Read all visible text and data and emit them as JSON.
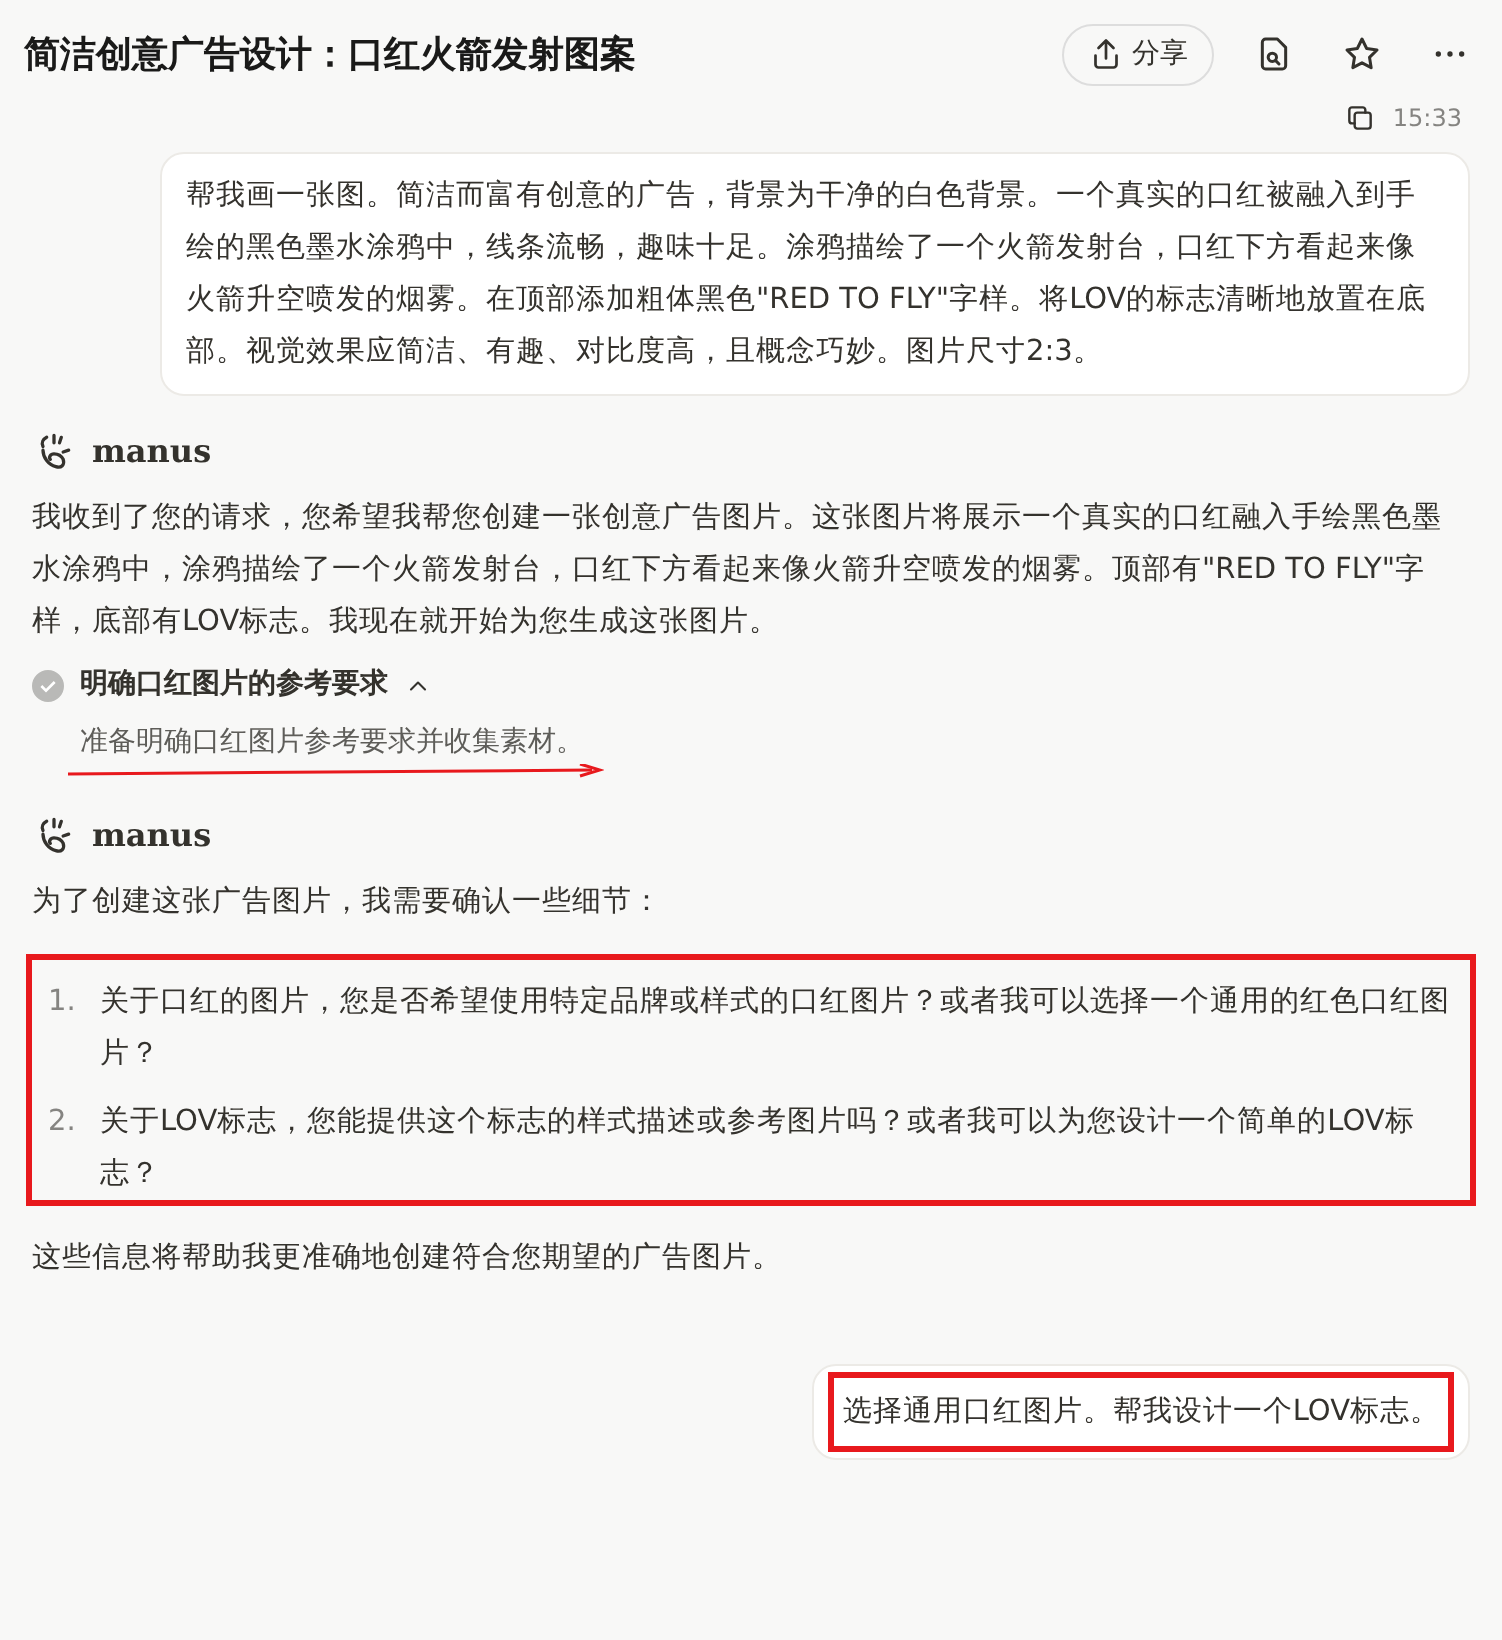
{
  "header": {
    "title": "简洁创意广告设计：口红火箭发射图案",
    "share_label": "分享"
  },
  "messages": [
    {
      "kind": "user",
      "time": "15:33",
      "text": "帮我画一张图。简洁而富有创意的广告，背景为干净的白色背景。一个真实的口红被融入到手绘的黑色墨水涂鸦中，线条流畅，趣味十足。涂鸦描绘了一个火箭发射台，口红下方看起来像火箭升空喷发的烟雾。在顶部添加粗体黑色\"RED TO FLY\"字样。将LOV的标志清晰地放置在底部。视觉效果应简洁、有趣、对比度高，且概念巧妙。图片尺寸2:3。"
    },
    {
      "kind": "assistant",
      "name": "manus",
      "paragraphs": [
        "我收到了您的请求，您希望我帮您创建一张创意广告图片。这张图片将展示一个真实的口红融入手绘黑色墨水涂鸦中，涂鸦描绘了一个火箭发射台，口红下方看起来像火箭升空喷发的烟雾。顶部有\"RED TO FLY\"字样，底部有LOV标志。我现在就开始为您生成这张图片。"
      ],
      "step": {
        "title": "明确口红图片的参考要求",
        "done": true,
        "expanded": true,
        "detail": "准备明确口红图片参考要求并收集素材。",
        "underlined": true
      }
    },
    {
      "kind": "assistant",
      "name": "manus",
      "paragraphs": [
        "为了创建这张广告图片，我需要确认一些细节："
      ],
      "list": {
        "highlighted": true,
        "items": [
          {
            "number": "1.",
            "text": "关于口红的图片，您是否希望使用特定品牌或样式的口红图片？或者我可以选择一个通用的红色口红图片？"
          },
          {
            "number": "2.",
            "text": "关于LOV标志，您能提供这个标志的样式描述或参考图片吗？或者我可以为您设计一个简单的LOV标志？"
          }
        ]
      },
      "after": "这些信息将帮助我更准确地创建符合您期望的广告图片。"
    },
    {
      "kind": "user",
      "text": "选择通用口红图片。帮我设计一个LOV标志。",
      "highlighted": true
    }
  ]
}
